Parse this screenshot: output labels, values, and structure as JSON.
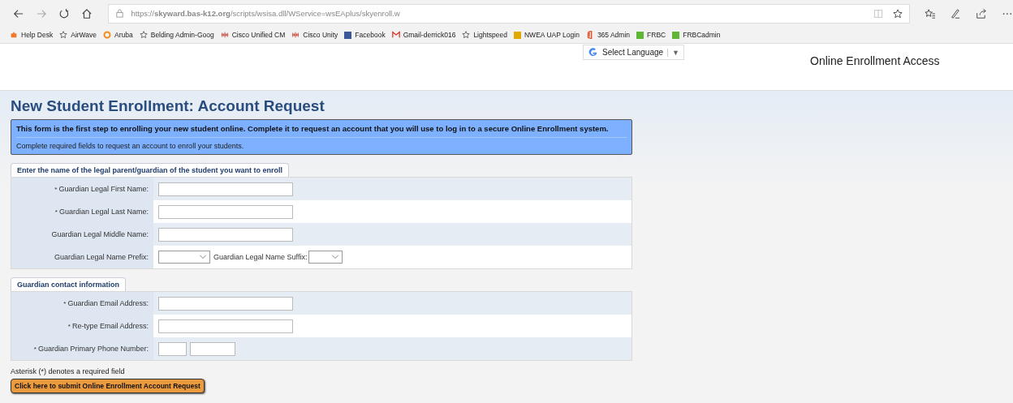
{
  "browser": {
    "url": "https://**skyward.bas-k12.org**/scripts/wsisa.dll/WService=wsEAplus/skyenroll.w"
  },
  "favorites": [
    {
      "kind": "puzzle",
      "label": "Help Desk"
    },
    {
      "kind": "star",
      "label": "AirWave"
    },
    {
      "kind": "ring",
      "label": "Aruba"
    },
    {
      "kind": "star",
      "label": "Belding Admin-Goog"
    },
    {
      "kind": "bars",
      "label": "Cisco Unified CM"
    },
    {
      "kind": "bars",
      "label": "Cisco Unity"
    },
    {
      "kind": "square",
      "color": "#3b5998",
      "label": "Facebook"
    },
    {
      "kind": "mail",
      "label": "Gmail-derrick016"
    },
    {
      "kind": "star",
      "label": "Lightspeed"
    },
    {
      "kind": "square",
      "color": "#e0a800",
      "label": "NWEA UAP Login"
    },
    {
      "kind": "office",
      "label": "365 Admin"
    },
    {
      "kind": "square",
      "color": "#5fb636",
      "label": "FRBC"
    },
    {
      "kind": "square",
      "color": "#5fb636",
      "label": "FRBCadmin"
    }
  ],
  "translate": {
    "label": "Select Language",
    "caret": "▼"
  },
  "header": {
    "title": "Online Enrollment Access"
  },
  "page": {
    "title": "New Student Enrollment: Account Request",
    "notice": {
      "headline": "This form is the first step to enrolling your new student online. Complete it to request an account that you will use to log in to a secure Online Enrollment system.",
      "text": "Complete required fields to request an account to enroll your students."
    },
    "sections": [
      {
        "title": "Enter the name of the legal parent/guardian of the student you want to enroll",
        "rows": [
          {
            "kind": "text",
            "marker": "*",
            "label": "Guardian Legal First Name:"
          },
          {
            "kind": "text",
            "marker": "*",
            "label": "Guardian Legal Last Name:"
          },
          {
            "kind": "text",
            "label": "Guardian Legal Middle Name:"
          },
          {
            "kind": "selects",
            "label": "Guardian Legal Name Prefix:",
            "second_label": "Guardian Legal Name Suffix:"
          }
        ]
      },
      {
        "title": "Guardian contact information",
        "rows": [
          {
            "kind": "text",
            "marker": "*",
            "label": "Guardian Email Address:"
          },
          {
            "kind": "text",
            "marker": "*",
            "label": "Re-type Email Address:"
          },
          {
            "kind": "phone",
            "marker": "*",
            "label": "Guardian Primary Phone Number:"
          }
        ]
      }
    ],
    "footnote": "Asterisk (*) denotes a required field",
    "submit": "Click here to submit Online Enrollment Account Request"
  }
}
